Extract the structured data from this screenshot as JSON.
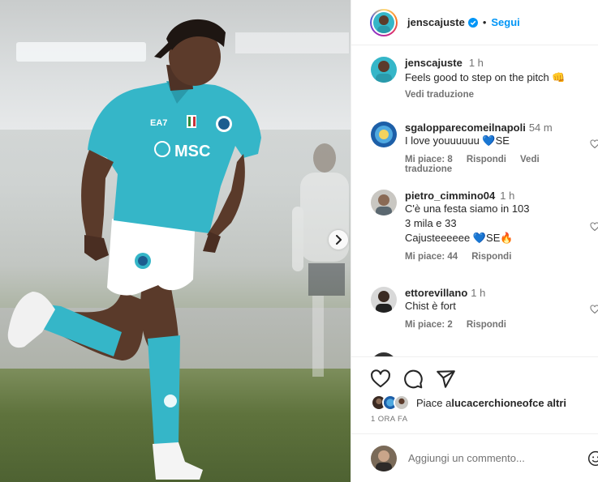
{
  "post": {
    "author": "jenscajuste",
    "follow_label": "Segui",
    "caption_time": "1 h",
    "caption": "Feels good to step on the pitch 👊",
    "see_translation": "Vedi traduzione",
    "jersey_text": "MSC",
    "jersey_sponsor": "EA7"
  },
  "comments": [
    {
      "user": "sgalopparecomeilnapoli",
      "time": "54 m",
      "text": "I love youuuuuu 💙SE",
      "likes_label": "Mi piace: 8",
      "reply_label": "Rispondi",
      "translate_label": "Vedi traduzione"
    },
    {
      "user": "pietro_cimmino04",
      "time": "1 h",
      "line1": "C'è una festa siamo in 103",
      "line2": "3 mila e 33",
      "line3": "Cajusteeeeee 💙SE🔥",
      "likes_label": "Mi piace: 44",
      "reply_label": "Rispondi"
    },
    {
      "user": "ettorevillano",
      "time": "1 h",
      "text": "Chist è fort",
      "likes_label": "Mi piace: 2",
      "reply_label": "Rispondi"
    }
  ],
  "likes": {
    "prefix": "Piace a ",
    "user": "lucacerchioneofc",
    "suffix": " e altri",
    "time_ago": "1 ORA FA"
  },
  "add_comment": {
    "placeholder": "Aggiungi un commento..."
  },
  "colors": {
    "jersey": "#35b6c8",
    "follow": "#0095f6",
    "muted": "#737373"
  }
}
